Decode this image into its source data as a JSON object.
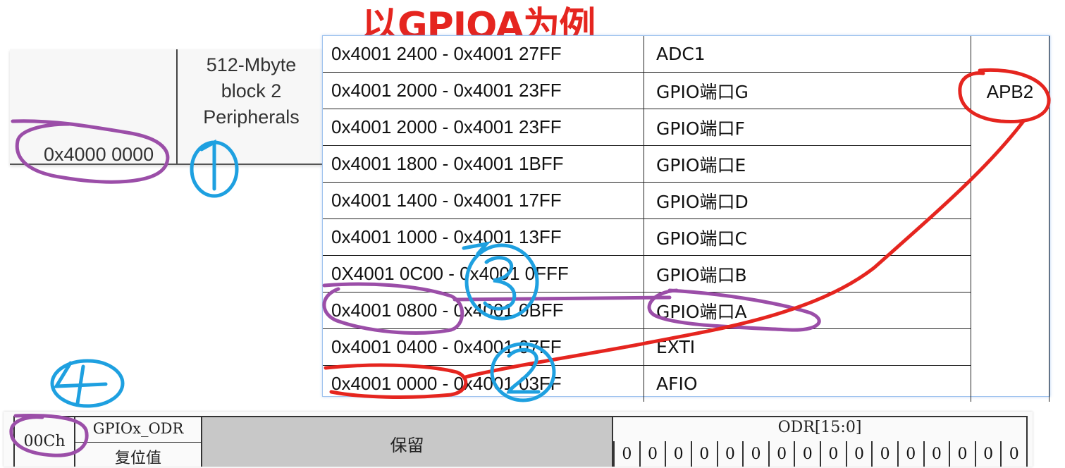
{
  "title": "以GPIOA为例",
  "memory_map": {
    "address": "0x4000 0000",
    "block_lines": [
      "512-Mbyte",
      "block 2",
      "Peripherals"
    ]
  },
  "address_table": {
    "rows": [
      {
        "range": "0x4001 2400 - 0x4001 27FF",
        "name": "ADC1"
      },
      {
        "range": "0x4001 2000 - 0x4001 23FF",
        "name": "GPIO端口G"
      },
      {
        "range": "0x4001 2000 - 0x4001 23FF",
        "name": "GPIO端口F"
      },
      {
        "range": "0x4001 1800 - 0x4001 1BFF",
        "name": "GPIO端口E"
      },
      {
        "range": "0x4001 1400 - 0x4001 17FF",
        "name": "GPIO端口D"
      },
      {
        "range": "0x4001 1000 - 0x4001 13FF",
        "name": "GPIO端口C"
      },
      {
        "range": "0X4001 0C00 - 0x4001 0FFF",
        "name": "GPIO端口B"
      },
      {
        "range": "0x4001 0800 - 0x4001 0BFF",
        "name": "GPIO端口A"
      },
      {
        "range": "0x4001 0400 - 0x4001 07FF",
        "name": "EXTI"
      },
      {
        "range": "0x4001 0000 - 0x4001 03FF",
        "name": "AFIO"
      }
    ],
    "bus": "APB2"
  },
  "register": {
    "offset": "00Ch",
    "name": "GPIOx_ODR",
    "reset_label": "复位值",
    "reserved": "保留",
    "field": "ODR[15:0]",
    "bits": [
      "0",
      "0",
      "0",
      "0",
      "0",
      "0",
      "0",
      "0",
      "0",
      "0",
      "0",
      "0",
      "0",
      "0",
      "0",
      "0"
    ]
  },
  "annotations": {
    "marks": [
      "1",
      "2",
      "3",
      "4"
    ],
    "colors": {
      "purple": "#9b4ea8",
      "red": "#e5251f",
      "blue": "#1ea0e0"
    }
  }
}
